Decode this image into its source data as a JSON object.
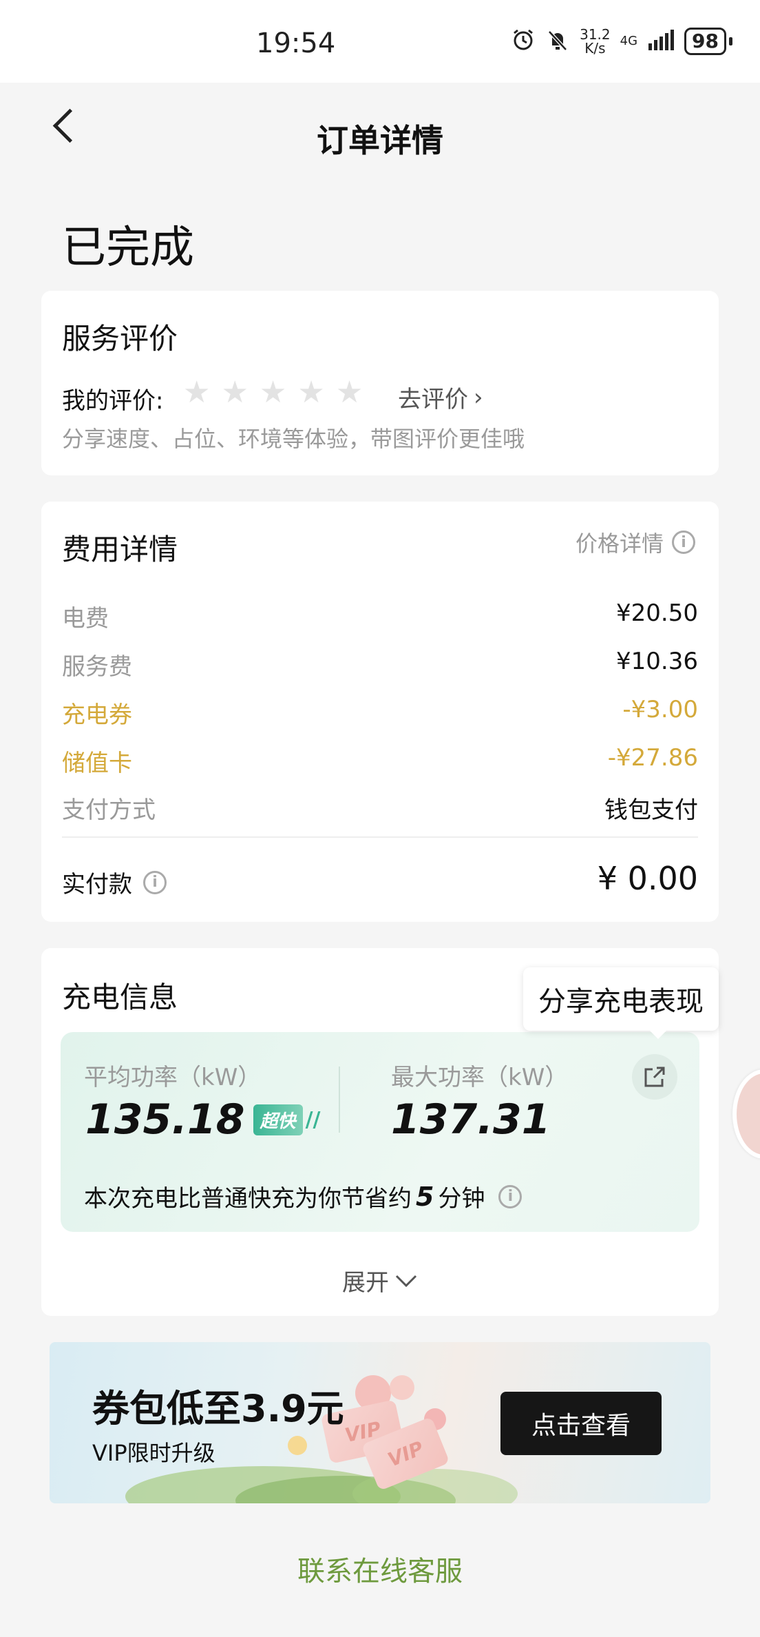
{
  "status_bar": {
    "time": "19:54",
    "net_speed": "31.2\nK/s",
    "network": "4G",
    "battery": "98"
  },
  "header": {
    "title": "订单详情"
  },
  "order_status": "已完成",
  "review": {
    "title": "服务评价",
    "my_review_label": "我的评价:",
    "rating": 0,
    "rating_max": 5,
    "go_review": "去评价",
    "hint": "分享速度、占位、环境等体验，带图评价更佳哦"
  },
  "fees": {
    "title": "费用详情",
    "price_detail": "价格详情",
    "rows": [
      {
        "label": "电费",
        "value": "¥20.50",
        "highlight": false
      },
      {
        "label": "服务费",
        "value": "¥10.36",
        "highlight": false
      },
      {
        "label": "充电券",
        "value": "-¥3.00",
        "highlight": true
      },
      {
        "label": "储值卡",
        "value": "-¥27.86",
        "highlight": true
      },
      {
        "label": "支付方式",
        "value": "钱包支付",
        "highlight": false
      }
    ],
    "paid_label": "实付款",
    "paid_value": "¥ 0.00"
  },
  "charging": {
    "title": "充电信息",
    "tooltip": "分享充电表现",
    "avg_label": "平均功率（kW）",
    "avg_value": "135.18",
    "badge": "超快",
    "max_label": "最大功率（kW）",
    "max_value": "137.31",
    "saving_pre": "本次充电比普通快充为你节省约",
    "saving_num": "5",
    "saving_post": "分钟",
    "expand": "展开"
  },
  "banner": {
    "title": "券包低至3.9元",
    "subtitle": "VIP限时升级",
    "button": "点击查看",
    "card_text": "VIP"
  },
  "contact": "联系在线客服",
  "colors": {
    "gold": "#d4a93a",
    "green_link": "#6e9a3e",
    "teal_badge": "#3ab594"
  }
}
